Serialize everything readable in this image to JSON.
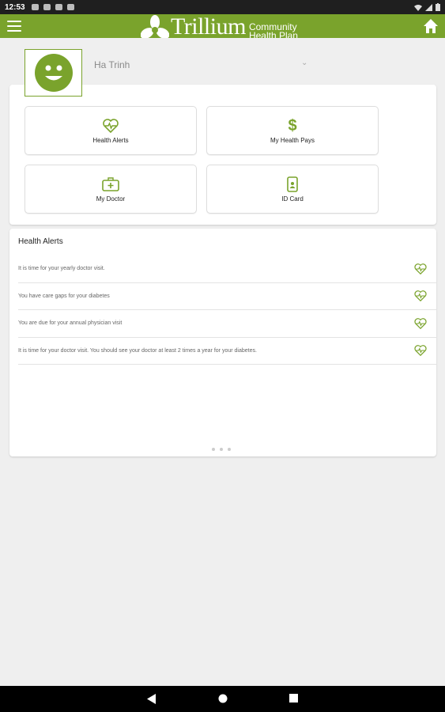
{
  "status_bar": {
    "time": "12:53"
  },
  "app_bar": {
    "logo_word": "Trillium",
    "logo_line1": "Community",
    "logo_line2": "Health Plan"
  },
  "profile": {
    "name": "Ha Trinh"
  },
  "tiles": [
    {
      "label": "Health Alerts",
      "icon": "heart-pulse-icon"
    },
    {
      "label": "My Health Pays",
      "icon": "dollar-icon",
      "symbol": "$"
    },
    {
      "label": "My Doctor",
      "icon": "medical-kit-icon"
    },
    {
      "label": "ID Card",
      "icon": "id-card-phone-icon"
    }
  ],
  "alerts": {
    "title": "Health Alerts",
    "items": [
      {
        "text": "It is time for your yearly doctor visit."
      },
      {
        "text": "You have care gaps for your diabetes"
      },
      {
        "text": "You are due for your annual physician visit"
      },
      {
        "text": "It is time for your doctor visit.  You should see your doctor at least 2 times a year for your diabetes."
      }
    ]
  },
  "colors": {
    "brand_green": "#7aa32c",
    "background": "#efefef",
    "status_bar": "#1f1f1f",
    "nav_bar": "#000000"
  }
}
